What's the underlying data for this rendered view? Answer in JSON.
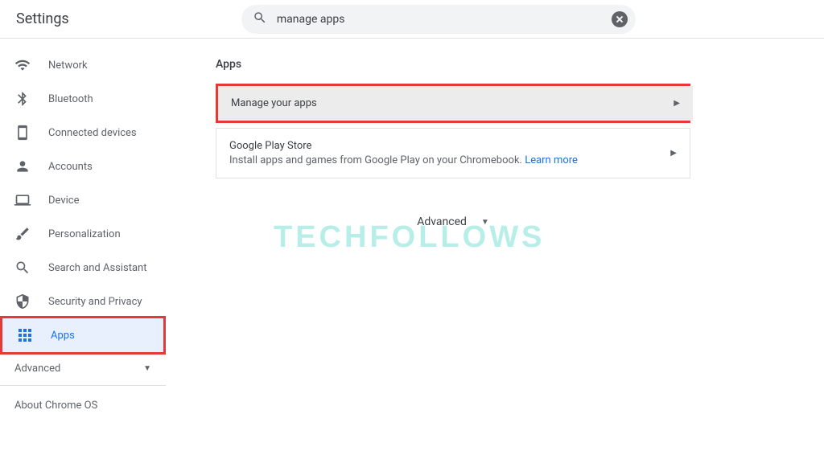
{
  "header": {
    "title": "Settings",
    "search_value": "manage apps"
  },
  "sidebar": {
    "items": [
      {
        "label": "Network"
      },
      {
        "label": "Bluetooth"
      },
      {
        "label": "Connected devices"
      },
      {
        "label": "Accounts"
      },
      {
        "label": "Device"
      },
      {
        "label": "Personalization"
      },
      {
        "label": "Search and Assistant"
      },
      {
        "label": "Security and Privacy"
      },
      {
        "label": "Apps"
      }
    ],
    "advanced": "Advanced",
    "about": "About Chrome OS"
  },
  "main": {
    "section_title": "Apps",
    "manage_apps": "Manage your apps",
    "play_store_title": "Google Play Store",
    "play_store_sub": "Install apps and games from Google Play on your Chromebook. ",
    "learn_more": "Learn more",
    "advanced": "Advanced"
  },
  "watermark": "TECHFOLLOWS"
}
